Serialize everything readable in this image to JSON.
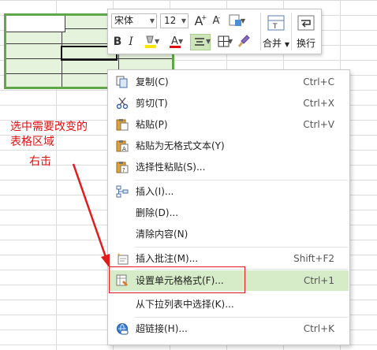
{
  "mini_toolbar": {
    "font_name": "宋体",
    "font_size": "12",
    "bold_label": "B",
    "italic_label": "I",
    "grow_font_label": "A",
    "shrink_font_label": "A",
    "merge_label": "合并",
    "wrap_label": "换行",
    "highlight_color": "#ffe600",
    "font_color": "#e01010"
  },
  "context_menu": {
    "items": [
      {
        "label": "复制(C)",
        "shortcut": "Ctrl+C",
        "icon": "copy-icon"
      },
      {
        "label": "剪切(T)",
        "shortcut": "Ctrl+X",
        "icon": "scissors-icon"
      },
      {
        "label": "粘贴(P)",
        "shortcut": "Ctrl+V",
        "icon": "paste-icon"
      },
      {
        "label": "粘贴为无格式文本(Y)",
        "shortcut": "",
        "icon": "paste-plain-icon"
      },
      {
        "label": "选择性粘贴(S)...",
        "shortcut": "",
        "icon": "paste-special-icon"
      },
      {
        "label": "插入(I)...",
        "shortcut": "",
        "icon": "insert-icon"
      },
      {
        "label": "删除(D)...",
        "shortcut": "",
        "icon": ""
      },
      {
        "label": "清除内容(N)",
        "shortcut": "",
        "icon": ""
      },
      {
        "label": "插入批注(M)...",
        "shortcut": "Shift+F2",
        "icon": "comment-icon"
      },
      {
        "label": "设置单元格格式(F)...",
        "shortcut": "Ctrl+1",
        "icon": "format-cells-icon"
      },
      {
        "label": "从下拉列表中选择(K)...",
        "shortcut": "",
        "icon": ""
      },
      {
        "label": "超链接(H)...",
        "shortcut": "Ctrl+K",
        "icon": "hyperlink-icon"
      }
    ],
    "highlight_color": "#d6ebc7"
  },
  "annotation": {
    "line1": "选中需要改变的",
    "line2": "表格区域",
    "line3": "右击",
    "color": "#e01010"
  }
}
